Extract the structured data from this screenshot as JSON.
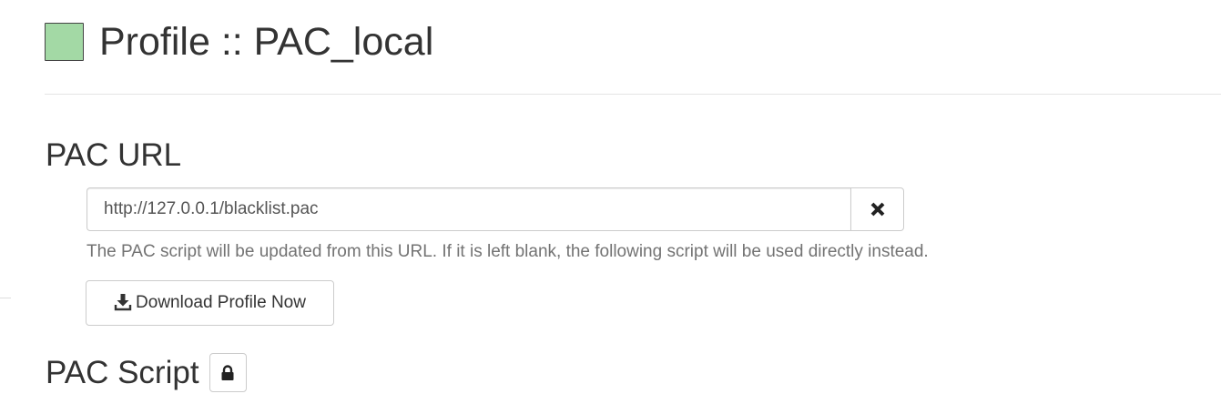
{
  "profile": {
    "title": "Profile :: PAC_local",
    "color": "#a3d9a5"
  },
  "pac_url_section": {
    "title": "PAC URL",
    "url_input": {
      "value": "http://127.0.0.1/blacklist.pac",
      "placeholder": ""
    },
    "clear_icon": "close-icon",
    "help_text": "The PAC script will be updated from this URL. If it is left blank, the following script will be used directly instead.",
    "download_button": {
      "icon": "download-icon",
      "label": "Download Profile Now"
    }
  },
  "pac_script_section": {
    "title": "PAC Script",
    "lock_icon": "lock-icon"
  },
  "colors": {
    "text": "#333333",
    "muted_text": "#737373",
    "border": "#cccccc",
    "divider": "#e5e5e5"
  }
}
